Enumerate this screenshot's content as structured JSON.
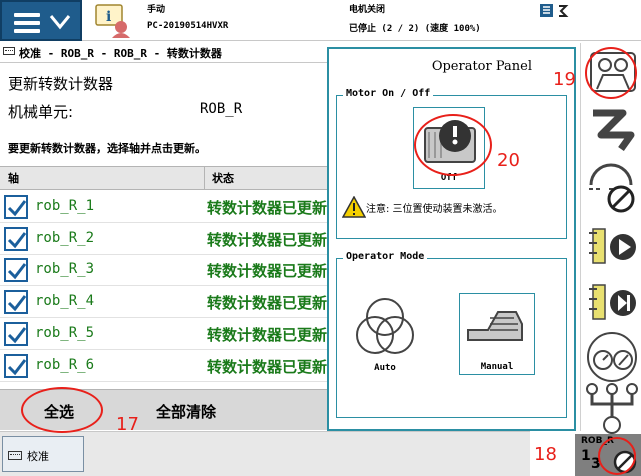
{
  "topbar": {
    "mode": "手动",
    "controller": "PC-20190514HVXR",
    "motors": "电机关闭",
    "run_state": "已停止 (2 / 2) (速度 100%)"
  },
  "app": {
    "title": "校准 - ROB_R - ROB_R - 转数计数器"
  },
  "page": {
    "heading": "更新转数计数器",
    "unit_label": "机械单元:",
    "unit_value": "ROB_R",
    "instruction": "要更新转数计数器，选择轴并点击更新。"
  },
  "table": {
    "headers": [
      "轴",
      "状态"
    ],
    "rows": [
      {
        "axis": "rob_R_1",
        "state": "转数计数器已更新",
        "checked": true
      },
      {
        "axis": "rob_R_2",
        "state": "转数计数器已更新",
        "checked": true
      },
      {
        "axis": "rob_R_3",
        "state": "转数计数器已更新",
        "checked": true
      },
      {
        "axis": "rob_R_4",
        "state": "转数计数器已更新",
        "checked": true
      },
      {
        "axis": "rob_R_5",
        "state": "转数计数器已更新",
        "checked": true
      },
      {
        "axis": "rob_R_6",
        "state": "转数计数器已更新",
        "checked": true
      }
    ]
  },
  "buttons": {
    "select_all": "全选",
    "clear_all": "全部清除"
  },
  "taskbar": {
    "task_label": "校准"
  },
  "operator_panel": {
    "title": "Operator Panel",
    "motor_group": "Motor On / Off",
    "motor_button": "Off",
    "warning": "注意: 三位置使动装置未激活。",
    "mode_group": "Operator Mode",
    "auto_label": "Auto",
    "manual_label": "Manual"
  },
  "quickset": {
    "unit": "ROB_R",
    "fraction_num": "1",
    "fraction_den": "3"
  },
  "annotations": {
    "n17": "17",
    "n18": "18",
    "n19": "19",
    "n20": "20"
  },
  "colors": {
    "accent": "#1f5c8c",
    "panel_border": "#2b8fa3",
    "status_green": "#1a7a1a",
    "annotation_red": "#e8201a"
  },
  "icons": [
    "menu-icon",
    "chevron-down-icon",
    "info-icon",
    "robot-icon",
    "jog-icon",
    "stop-icon",
    "run-icon",
    "step-icon",
    "speed-icon",
    "increment-icon",
    "warning-icon",
    "motor-icon"
  ]
}
